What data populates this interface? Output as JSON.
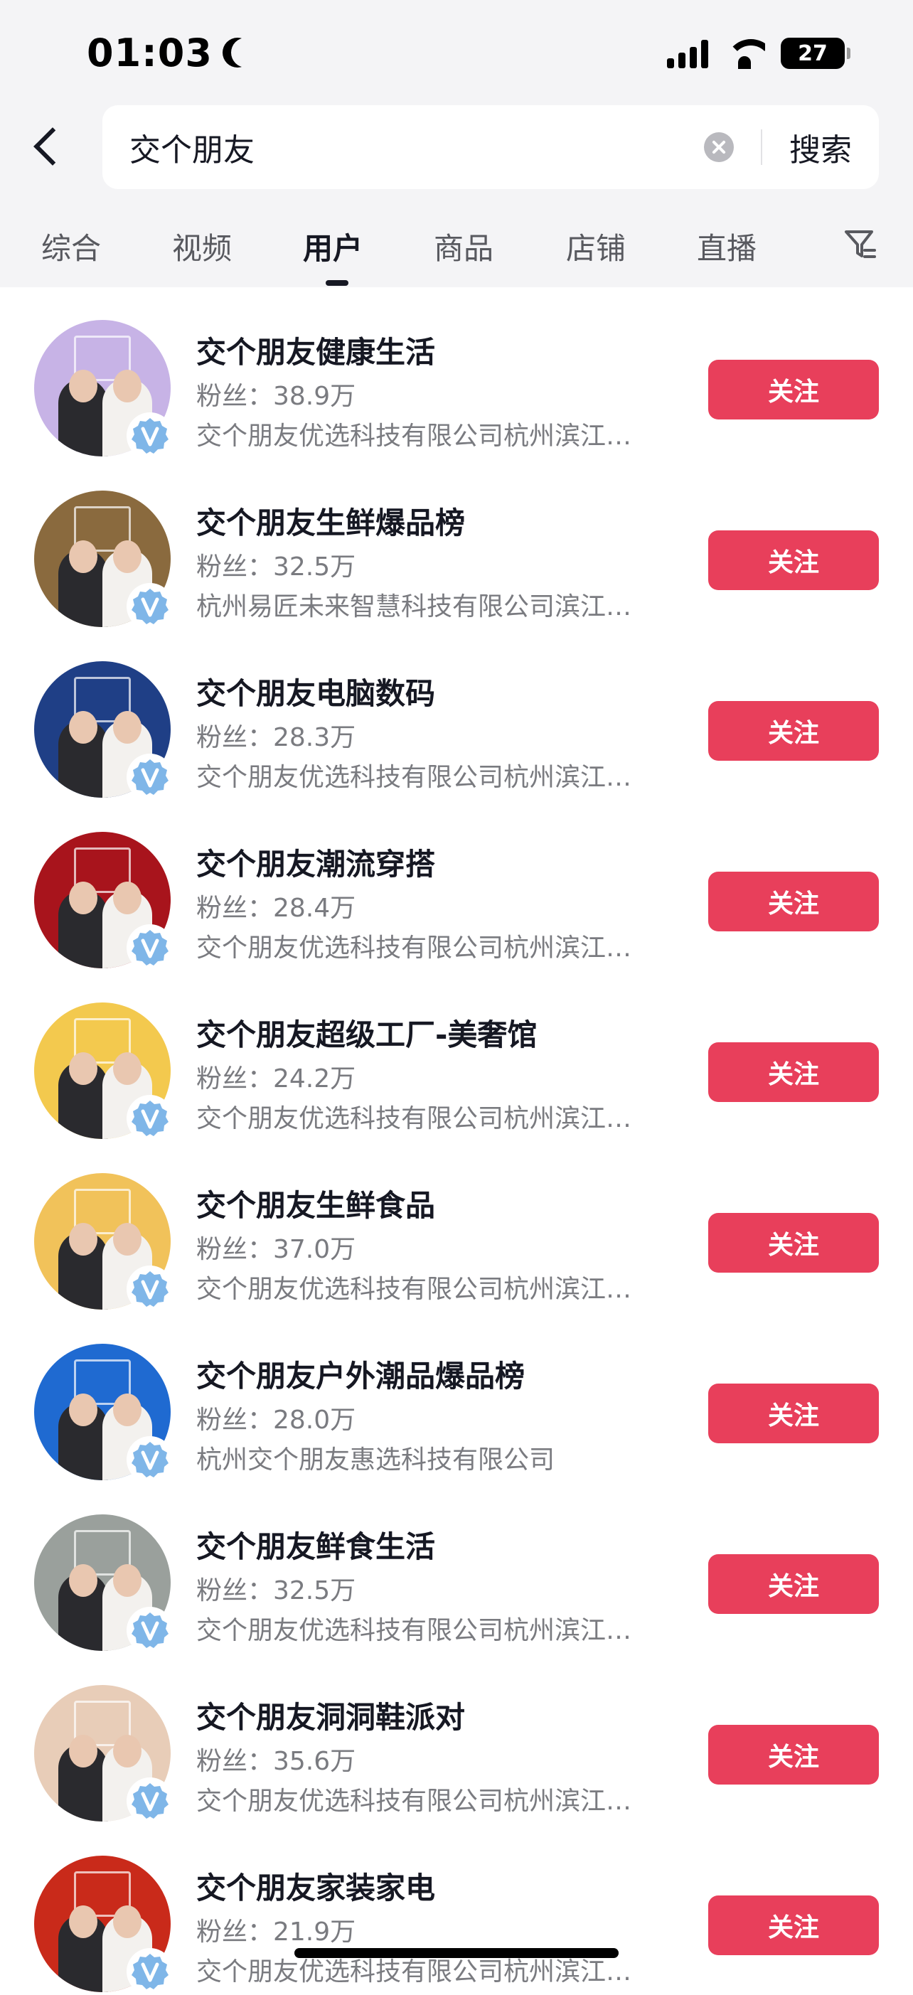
{
  "status_bar": {
    "time": "01:03",
    "battery": "27"
  },
  "search": {
    "query": "交个朋友",
    "button_label": "搜索"
  },
  "tabs": [
    {
      "label": "综合"
    },
    {
      "label": "视频"
    },
    {
      "label": "用户",
      "active": true
    },
    {
      "label": "商品"
    },
    {
      "label": "店铺"
    },
    {
      "label": "直播"
    }
  ],
  "users": [
    {
      "name": "交个朋友健康生活",
      "fans": "粉丝：38.9万",
      "desc": "交个朋友优选科技有限公司杭州滨江…",
      "follow_label": "关注",
      "avatar_bg": "#c7b3e6"
    },
    {
      "name": "交个朋友生鲜爆品榜",
      "fans": "粉丝：32.5万",
      "desc": "杭州易匠未来智慧科技有限公司滨江…",
      "follow_label": "关注",
      "avatar_bg": "#8a6a3e"
    },
    {
      "name": "交个朋友电脑数码",
      "fans": "粉丝：28.3万",
      "desc": "交个朋友优选科技有限公司杭州滨江…",
      "follow_label": "关注",
      "avatar_bg": "#1f3f86"
    },
    {
      "name": "交个朋友潮流穿搭",
      "fans": "粉丝：28.4万",
      "desc": "交个朋友优选科技有限公司杭州滨江…",
      "follow_label": "关注",
      "avatar_bg": "#a8141c"
    },
    {
      "name": "交个朋友超级工厂-美奢馆",
      "fans": "粉丝：24.2万",
      "desc": "交个朋友优选科技有限公司杭州滨江…",
      "follow_label": "关注",
      "avatar_bg": "#f3c94e"
    },
    {
      "name": "交个朋友生鲜食品",
      "fans": "粉丝：37.0万",
      "desc": "交个朋友优选科技有限公司杭州滨江…",
      "follow_label": "关注",
      "avatar_bg": "#f1c25a"
    },
    {
      "name": "交个朋友户外潮品爆品榜",
      "fans": "粉丝：28.0万",
      "desc": "杭州交个朋友惠选科技有限公司",
      "follow_label": "关注",
      "avatar_bg": "#1f6ad1"
    },
    {
      "name": "交个朋友鲜食生活",
      "fans": "粉丝：32.5万",
      "desc": "交个朋友优选科技有限公司杭州滨江…",
      "follow_label": "关注",
      "avatar_bg": "#9aa09c"
    },
    {
      "name": "交个朋友洞洞鞋派对",
      "fans": "粉丝：35.6万",
      "desc": "交个朋友优选科技有限公司杭州滨江…",
      "follow_label": "关注",
      "avatar_bg": "#e8cdb8"
    },
    {
      "name": "交个朋友家装家电",
      "fans": "粉丝：21.9万",
      "desc": "交个朋友优选科技有限公司杭州滨江…",
      "follow_label": "关注",
      "avatar_bg": "#c92a1a"
    }
  ],
  "colors": {
    "accent": "#e83f5b",
    "verified": "#7fb6e8",
    "header_bg": "#f4f4f6"
  }
}
